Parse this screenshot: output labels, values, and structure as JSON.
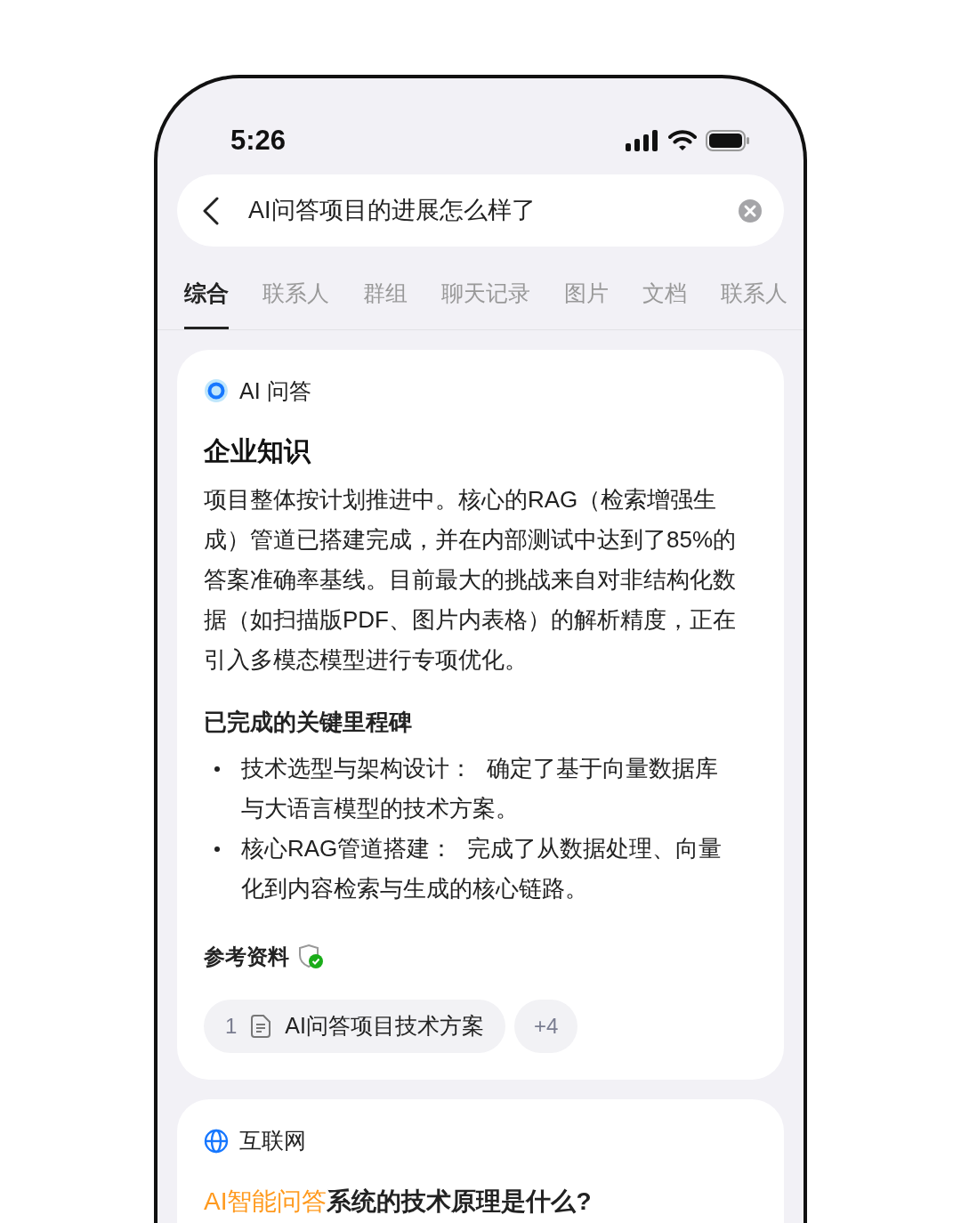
{
  "status_bar": {
    "time": "5:26"
  },
  "search": {
    "value": "AI问答项目的进展怎么样了"
  },
  "tabs": [
    {
      "label": "综合",
      "selected": true
    },
    {
      "label": "联系人",
      "selected": false
    },
    {
      "label": "群组",
      "selected": false
    },
    {
      "label": "聊天记录",
      "selected": false
    },
    {
      "label": "图片",
      "selected": false
    },
    {
      "label": "文档",
      "selected": false
    },
    {
      "label": "联系人",
      "selected": false
    }
  ],
  "ai_card": {
    "label": "AI 问答",
    "title": "企业知识",
    "summary": "项目整体按计划推进中。核心的RAG（检索增强生成）管道已搭建完成，并在内部测试中达到了85%的答案准确率基线。目前最大的挑战来自对非结构化数据（如扫描版PDF、图片内表格）的解析精度，正在引入多模态模型进行专项优化。",
    "milestones_title": "已完成的关键里程碑",
    "milestones": [
      {
        "term": "技术选型与架构设计：",
        "text": "确定了基于向量数据库与大语言模型的技术方案。"
      },
      {
        "term": "核心RAG管道搭建：",
        "text": "完成了从数据处理、向量化到内容检索与生成的核心链路。"
      }
    ],
    "references_title": "参考资料",
    "references": [
      {
        "index": "1",
        "title": "AI问答项目技术方案"
      }
    ],
    "more": "+4"
  },
  "web_card": {
    "label": "互联网",
    "question_highlight": "AI智能问答",
    "question_rest": "系统的技术原理是什么?"
  }
}
